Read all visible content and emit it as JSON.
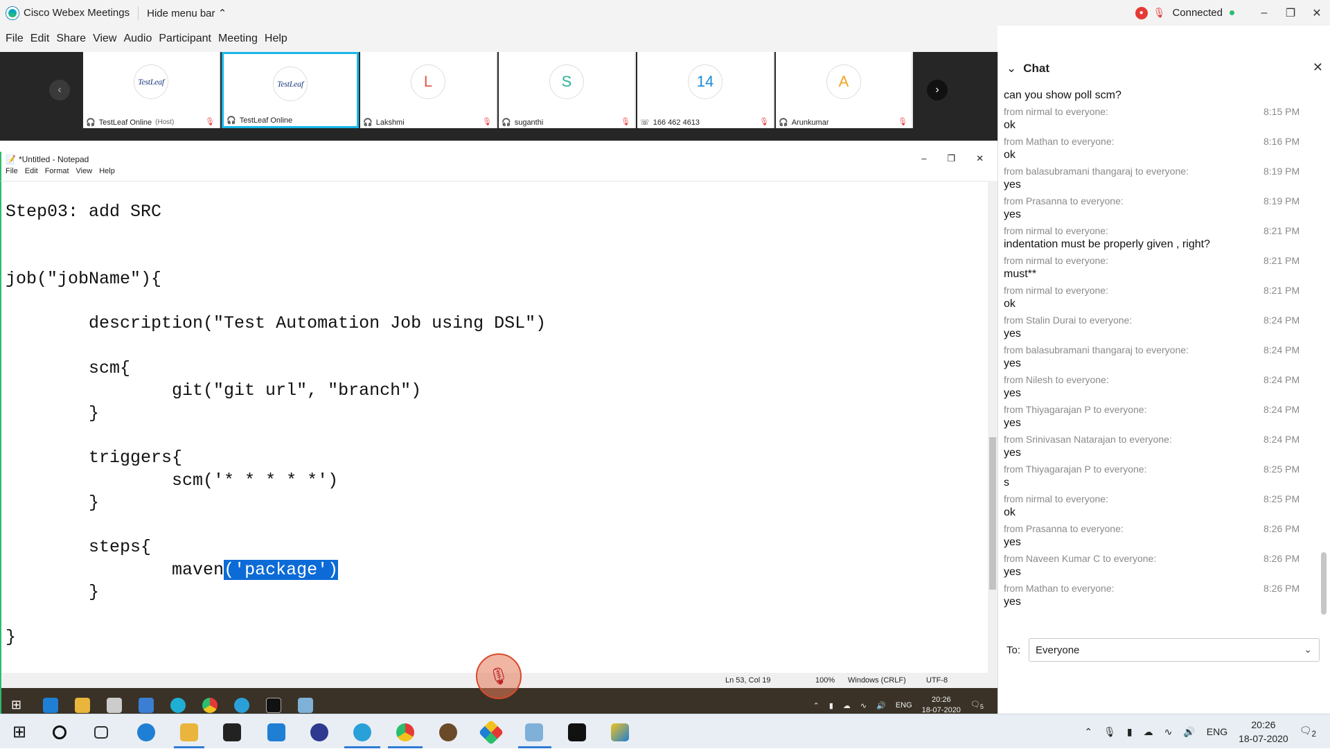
{
  "window": {
    "app_title": "Cisco Webex Meetings",
    "hide_menu": "Hide menu bar",
    "status": "Connected",
    "minimize": "–",
    "restore": "❐",
    "close": "✕"
  },
  "menu": [
    "File",
    "Edit",
    "Share",
    "View",
    "Audio",
    "Participant",
    "Meeting",
    "Help"
  ],
  "participants": [
    {
      "name": "TestLeaf Online",
      "role": "(Host)",
      "avatar": "TestLeaf",
      "logo": true
    },
    {
      "name": "TestLeaf Online",
      "role": "",
      "avatar": "TestLeaf",
      "logo": true
    },
    {
      "name": "Lakshmi",
      "role": "",
      "avatar": "L",
      "color": "#e4584a"
    },
    {
      "name": "suganthi",
      "role": "",
      "avatar": "S",
      "color": "#2bb39b"
    },
    {
      "name": "166 462 4613",
      "role": "",
      "avatar": "14",
      "color": "#1a8bd8"
    },
    {
      "name": "Arunkumar",
      "role": "",
      "avatar": "A",
      "color": "#f2a51e"
    }
  ],
  "notepad": {
    "title": "*Untitled - Notepad",
    "menu": [
      "File",
      "Edit",
      "Format",
      "View",
      "Help"
    ],
    "status": {
      "position": "Ln 53, Col 19",
      "zoom": "100%",
      "eol": "Windows (CRLF)",
      "encoding": "UTF-8"
    },
    "code": {
      "l1": "Step03: add SRC",
      "l2": "",
      "l3": "",
      "l4": "job(\"jobName\"){",
      "l5": "",
      "l6": "        description(\"Test Automation Job using DSL\")",
      "l7": "",
      "l8": "        scm{",
      "l9": "                git(\"git url\", \"branch\")",
      "l10": "        }",
      "l11": "",
      "l12": "        triggers{",
      "l13": "                scm('* * * * *')",
      "l14": "        }",
      "l15": "",
      "l16": "        steps{",
      "l17a": "                maven",
      "l17b": "('package')",
      "l18": "        }",
      "l19": "",
      "l20": "}"
    }
  },
  "inner_taskbar": {
    "lang": "ENG",
    "time": "20:26",
    "date": "18-07-2020",
    "notif": "5"
  },
  "chat": {
    "title": "Chat",
    "first_message": "can you show poll scm?",
    "messages": [
      {
        "from": "from nirmal to everyone:",
        "time": "8:15 PM",
        "text": "ok"
      },
      {
        "from": "from Mathan to everyone:",
        "time": "8:16 PM",
        "text": "ok"
      },
      {
        "from": "from balasubramani thangaraj to everyone:",
        "time": "8:19 PM",
        "text": "yes"
      },
      {
        "from": "from Prasanna to everyone:",
        "time": "8:19 PM",
        "text": "yes"
      },
      {
        "from": "from nirmal to everyone:",
        "time": "8:21 PM",
        "text": "indentation must be properly given , right?"
      },
      {
        "from": "from nirmal to everyone:",
        "time": "8:21 PM",
        "text": "must**"
      },
      {
        "from": "from nirmal to everyone:",
        "time": "8:21 PM",
        "text": "ok"
      },
      {
        "from": "from Stalin Durai to everyone:",
        "time": "8:24 PM",
        "text": "yes"
      },
      {
        "from": "from balasubramani thangaraj to everyone:",
        "time": "8:24 PM",
        "text": "yes"
      },
      {
        "from": "from Nilesh to everyone:",
        "time": "8:24 PM",
        "text": "yes"
      },
      {
        "from": "from Thiyagarajan P to everyone:",
        "time": "8:24 PM",
        "text": "yes"
      },
      {
        "from": "from Srinivasan Natarajan to everyone:",
        "time": "8:24 PM",
        "text": "yes"
      },
      {
        "from": "from Thiyagarajan P to everyone:",
        "time": "8:25 PM",
        "text": "s"
      },
      {
        "from": "from nirmal to everyone:",
        "time": "8:25 PM",
        "text": "ok"
      },
      {
        "from": "from Prasanna to everyone:",
        "time": "8:26 PM",
        "text": "yes"
      },
      {
        "from": "from Naveen Kumar C to everyone:",
        "time": "8:26 PM",
        "text": "yes"
      },
      {
        "from": "from Mathan to everyone:",
        "time": "8:26 PM",
        "text": "yes"
      }
    ],
    "to_label": "To:",
    "to_value": "Everyone"
  },
  "taskbar": {
    "lang": "ENG",
    "time": "20:26",
    "date": "18-07-2020",
    "notif": "2"
  }
}
